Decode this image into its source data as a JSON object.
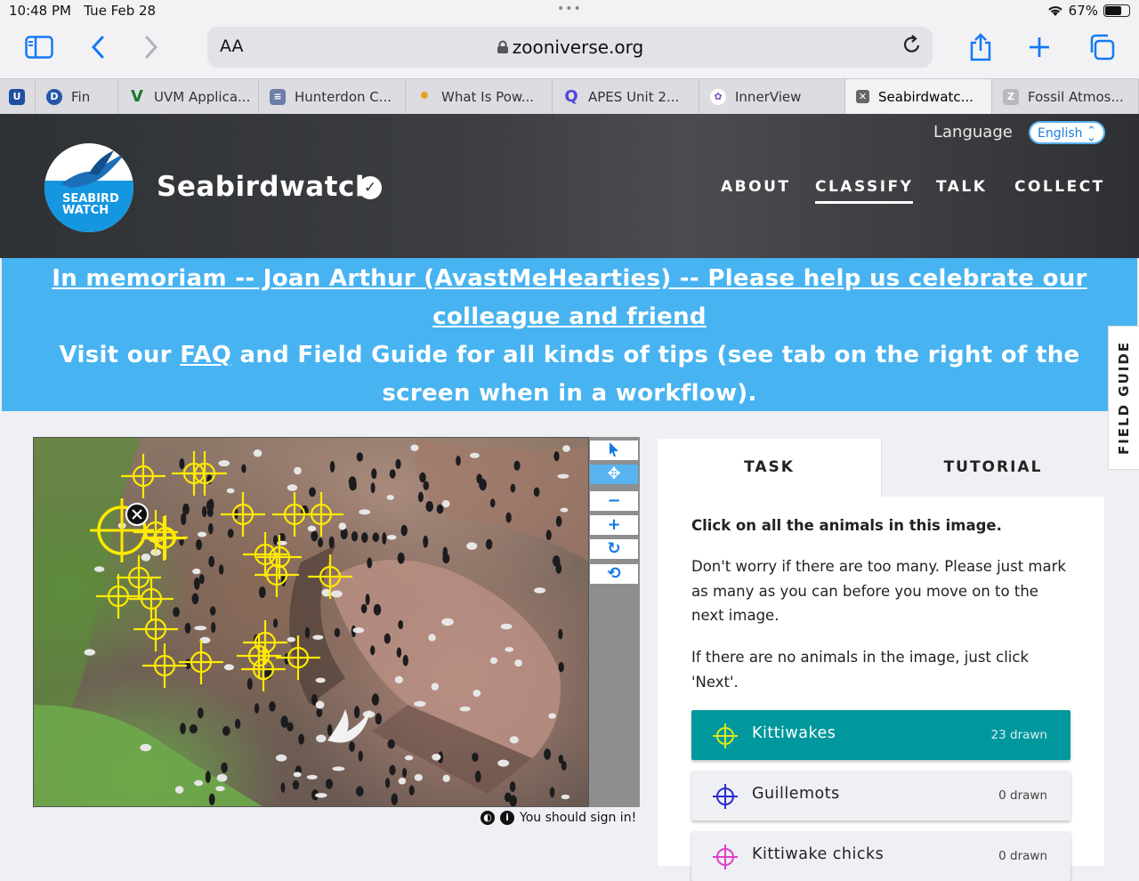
{
  "status": {
    "time": "10:48 PM",
    "date": "Tue Feb 28",
    "battery": "67%"
  },
  "browser": {
    "aa": "AA",
    "url": "zooniverse.org",
    "tabs": [
      {
        "label": "",
        "fav_color": "#1e4fa0",
        "fav_text": "U"
      },
      {
        "label": "Fin",
        "fav_color": "#2657a8",
        "fav_text": "D"
      },
      {
        "label": "UVM Applica...",
        "fav_color": "#1c7a2c",
        "fav_text": "V"
      },
      {
        "label": "Hunterdon C...",
        "fav_color": "#6d7ea8",
        "fav_text": "≡"
      },
      {
        "label": "What Is Pow...",
        "fav_color": "#e8a020",
        "fav_text": "•"
      },
      {
        "label": "APES Unit 2...",
        "fav_color": "#5044d8",
        "fav_text": "Q"
      },
      {
        "label": "InnerView",
        "fav_color": "#7a4ac0",
        "fav_text": "✿"
      },
      {
        "label": "Seabirdwatc...",
        "fav_color": "#666",
        "fav_text": "✕",
        "active": true
      },
      {
        "label": "Fossil Atmos...",
        "fav_color": "#b8b8c0",
        "fav_text": "Z"
      }
    ]
  },
  "header": {
    "language_label": "Language",
    "language_value": "English",
    "logo_text_1": "SEABIRD",
    "logo_text_2": "WATCH",
    "title": "Seabirdwatch",
    "nav": [
      "ABOUT",
      "CLASSIFY",
      "TALK",
      "COLLECT"
    ],
    "nav_active": "CLASSIFY"
  },
  "banner": {
    "line1": "In memoriam -- Joan Arthur (AvastMeHearties) -- Please help us celebrate our colleague and friend",
    "line2_pre": "Visit our ",
    "line2_link": "FAQ",
    "line2_post": " and Field Guide for all kinds of tips (see tab on the right of the screen when in a workflow)."
  },
  "field_guide": "FIELD GUIDE",
  "footer_note": "You should sign in!",
  "panel": {
    "tab_task": "TASK",
    "tab_tutorial": "TUTORIAL",
    "question": "Click on all the animals in this image.",
    "help1": "Don't worry if there are too many. Please just mark as many as you can before you move on to the next image.",
    "help2": "If there are no animals in the image, just click 'Next'.",
    "choices": [
      {
        "name": "Kittiwakes",
        "count": "23 drawn",
        "color": "#d8e81a",
        "selected": true
      },
      {
        "name": "Guillemots",
        "count": "0 drawn",
        "color": "#2a2ad0",
        "selected": false
      },
      {
        "name": "Kittiwake chicks",
        "count": "0 drawn",
        "color": "#e040c8",
        "selected": false
      }
    ]
  },
  "colors": {
    "accent_blue": "#48b3f1",
    "teal": "#00979d",
    "marker_yellow": "#ffea00"
  }
}
